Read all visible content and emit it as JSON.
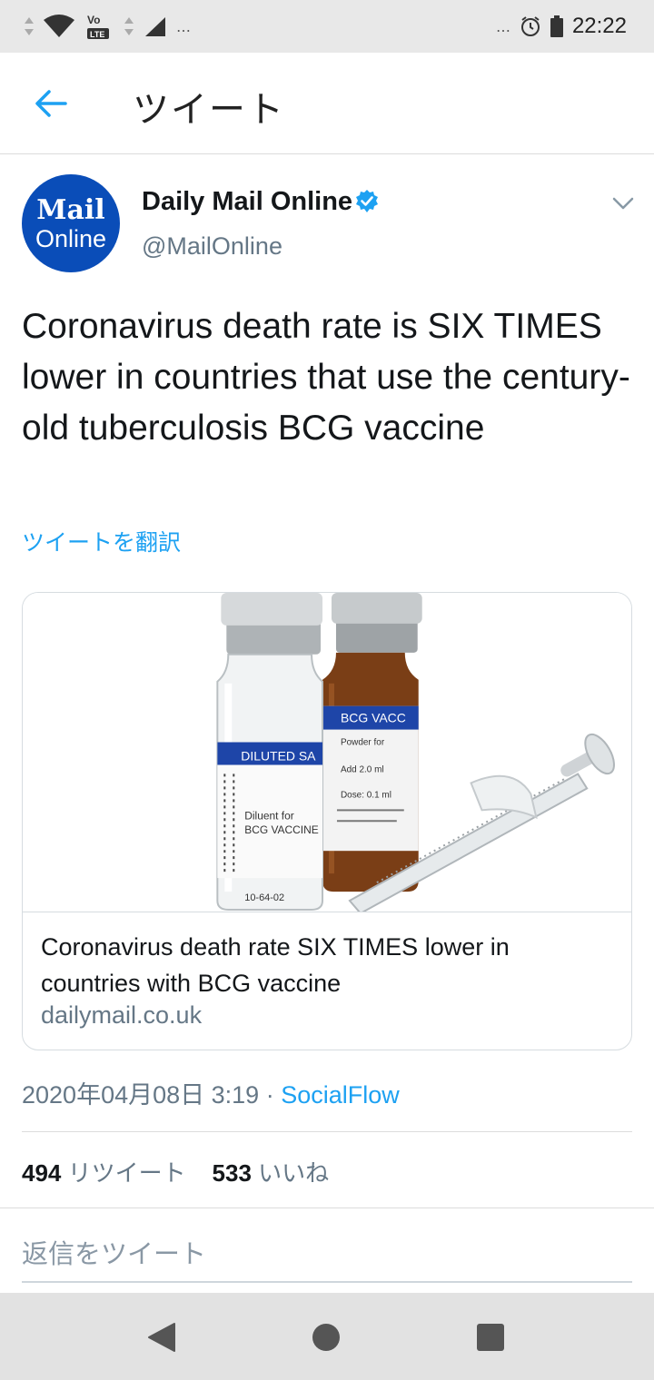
{
  "status_bar": {
    "time": "22:22",
    "dots_left": "…",
    "dots_right": "…",
    "volte_label": "Vo",
    "lte_label": "LTE"
  },
  "header": {
    "title": "ツイート"
  },
  "tweet": {
    "author_name": "Daily Mail Online",
    "author_handle": "@MailOnline",
    "avatar_line1": "Mail",
    "avatar_line2": "Online",
    "text": "Coronavirus death rate is SIX TIMES lower in countries that use the century-old tuberculosis BCG vaccine",
    "translate_label": "ツイートを翻訳",
    "card": {
      "title": "Coronavirus death rate SIX TIMES lower in countries with BCG vaccine",
      "domain": "dailymail.co.uk",
      "image_text": {
        "vial_left_label": "DILUTED SA",
        "vial_left_body1": "Diluent for",
        "vial_left_body2": "BCG VACCINE",
        "vial_left_lot": "10-64-02",
        "vial_right_label": "BCG VACC",
        "vial_right_body1": "Powder for",
        "vial_right_body2": "Add 2.0 ml",
        "vial_right_body3": "Dose: 0.1 ml"
      }
    },
    "timestamp": "2020年04月08日 3:19",
    "separator": " · ",
    "source": "SocialFlow",
    "retweets_count": "494",
    "retweets_label": "リツイート",
    "likes_count": "533",
    "likes_label": "いいね",
    "reply_placeholder": "返信をツイート"
  },
  "colors": {
    "accent": "#1da1f2",
    "avatar_bg": "#0a4db8",
    "muted": "#657786"
  }
}
